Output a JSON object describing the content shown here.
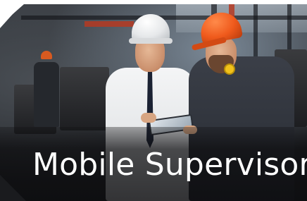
{
  "banner": {
    "headline": "Mobile Supervisor"
  },
  "photo": {
    "subject_icon": "industrial-workers-photo"
  },
  "colors": {
    "caption_band": "#0c0c0e",
    "headline_text": "#ffffff",
    "helmet_white": "#e6e8ea",
    "helmet_orange": "#ef5a1c"
  }
}
